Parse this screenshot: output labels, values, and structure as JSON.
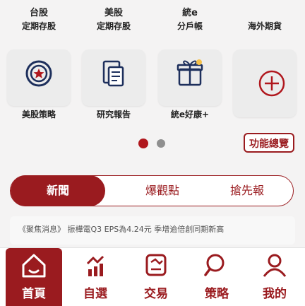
{
  "top_row": [
    {
      "line1": "台股",
      "line2": "定期存股"
    },
    {
      "line1": "美股",
      "line2": "定期存股"
    },
    {
      "line1": "統e",
      "line2": "分戶帳"
    },
    {
      "line1": "",
      "line2": "海外期貨"
    }
  ],
  "tiles": [
    {
      "label": "美股策略",
      "icon": "star-shield-icon"
    },
    {
      "label": "研究報告",
      "icon": "report-document-icon"
    },
    {
      "label": "統e好康+",
      "icon": "gift-icon"
    },
    {
      "label": "",
      "icon": "plus-circle-icon"
    }
  ],
  "pager": {
    "active_color": "#b0171d",
    "inactive_color": "#8f8f8f"
  },
  "feature_overview_label": "功能總覽",
  "tabs": {
    "active": "新聞",
    "items": [
      "爆觀點",
      "搶先報"
    ]
  },
  "news": {
    "headline": "《聚焦消息》 振樺電Q3 EPS為4.24元 季增逾倍創同期新高"
  },
  "bottom_nav": [
    {
      "label": "首頁",
      "icon": "home-icon"
    },
    {
      "label": "自選",
      "icon": "watchlist-chart-icon"
    },
    {
      "label": "交易",
      "icon": "trade-icon"
    },
    {
      "label": "策略",
      "icon": "search-strategy-icon"
    },
    {
      "label": "我的",
      "icon": "profile-icon"
    }
  ],
  "colors": {
    "brand": "#9a1b1f",
    "background": "#f4f3f3"
  }
}
